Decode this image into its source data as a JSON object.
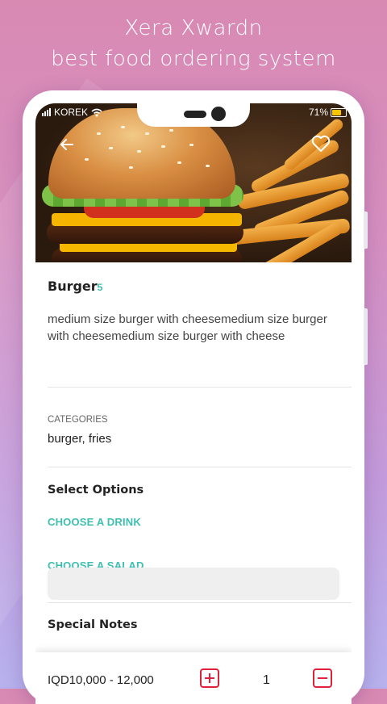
{
  "promo": {
    "line1": "Xera Xwardn",
    "line2": "best food ordering system"
  },
  "status_bar": {
    "carrier": "KOREK",
    "battery_text": "71%",
    "battery_level": 0.71
  },
  "product": {
    "name": "Burger",
    "count": "5",
    "description": "medium size burger with cheesemedium size burger with cheesemedium size burger with cheese"
  },
  "categories": {
    "label": "CATEGORIES",
    "value": "burger, fries"
  },
  "options": {
    "title": "Select Options",
    "drink_label": "CHOOSE A DRINK",
    "salad_label": "CHOOSE A SALAD"
  },
  "notes": {
    "title": "Special Notes"
  },
  "order": {
    "price_range": "IQD10,000 - 12,000",
    "quantity": "1"
  },
  "colors": {
    "accent": "#3dbfb0",
    "danger": "#e0213b"
  },
  "icons": [
    "wifi-icon",
    "signal-icon",
    "battery-icon",
    "back-arrow-icon",
    "heart-icon",
    "plus-icon",
    "minus-icon"
  ]
}
